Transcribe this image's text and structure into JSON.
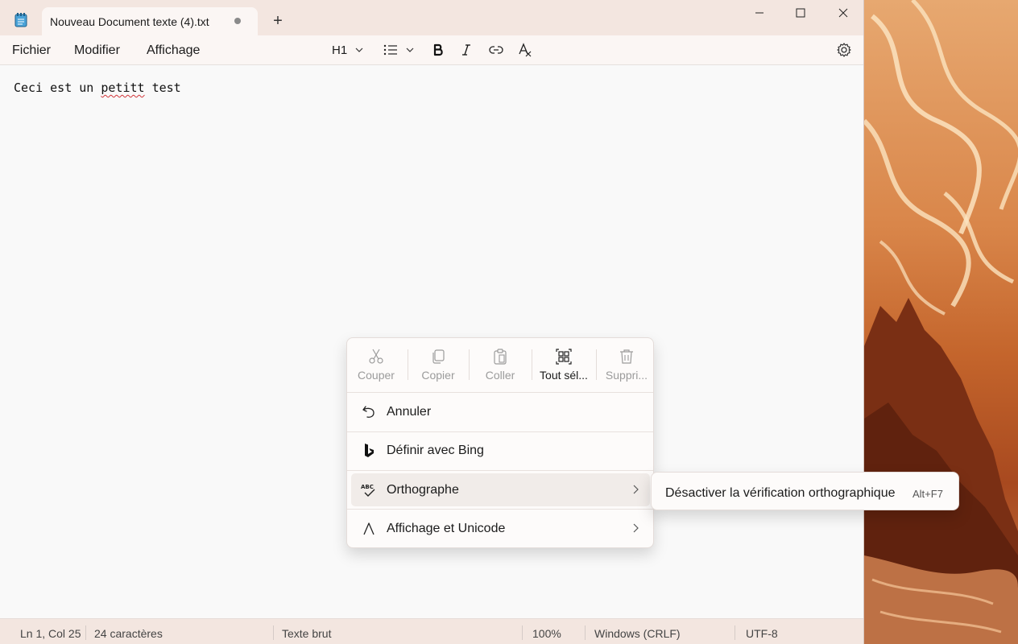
{
  "titlebar": {
    "tab_title": "Nouveau Document texte (4).txt",
    "new_tab_label": "+"
  },
  "menubar": {
    "file": "Fichier",
    "edit": "Modifier",
    "view": "Affichage",
    "heading_selector": "H1"
  },
  "editor": {
    "text_before": "Ceci est un ",
    "misspelled_word": "petitt",
    "text_after": " test"
  },
  "statusbar": {
    "position": "Ln 1, Col 25",
    "char_count": "24 caractères",
    "format": "Texte brut",
    "zoom": "100%",
    "line_ending": "Windows (CRLF)",
    "encoding": "UTF-8"
  },
  "context_menu": {
    "quick_actions": [
      {
        "label": "Couper",
        "icon": "scissors-icon",
        "enabled": false
      },
      {
        "label": "Copier",
        "icon": "copy-icon",
        "enabled": false
      },
      {
        "label": "Coller",
        "icon": "paste-icon",
        "enabled": false
      },
      {
        "label": "Tout sél...",
        "icon": "select-all-icon",
        "enabled": true
      },
      {
        "label": "Suppri...",
        "icon": "trash-icon",
        "enabled": false
      }
    ],
    "items": [
      {
        "label": "Annuler",
        "icon": "undo-icon"
      },
      {
        "label": "Définir avec Bing",
        "icon": "bing-icon"
      },
      {
        "label": "Orthographe",
        "icon": "spellcheck-icon",
        "submenu": true
      },
      {
        "label": "Affichage et Unicode",
        "icon": "lambda-icon",
        "submenu": true
      }
    ]
  },
  "submenu": {
    "label": "Désactiver la vérification orthographique",
    "shortcut": "Alt+F7"
  }
}
